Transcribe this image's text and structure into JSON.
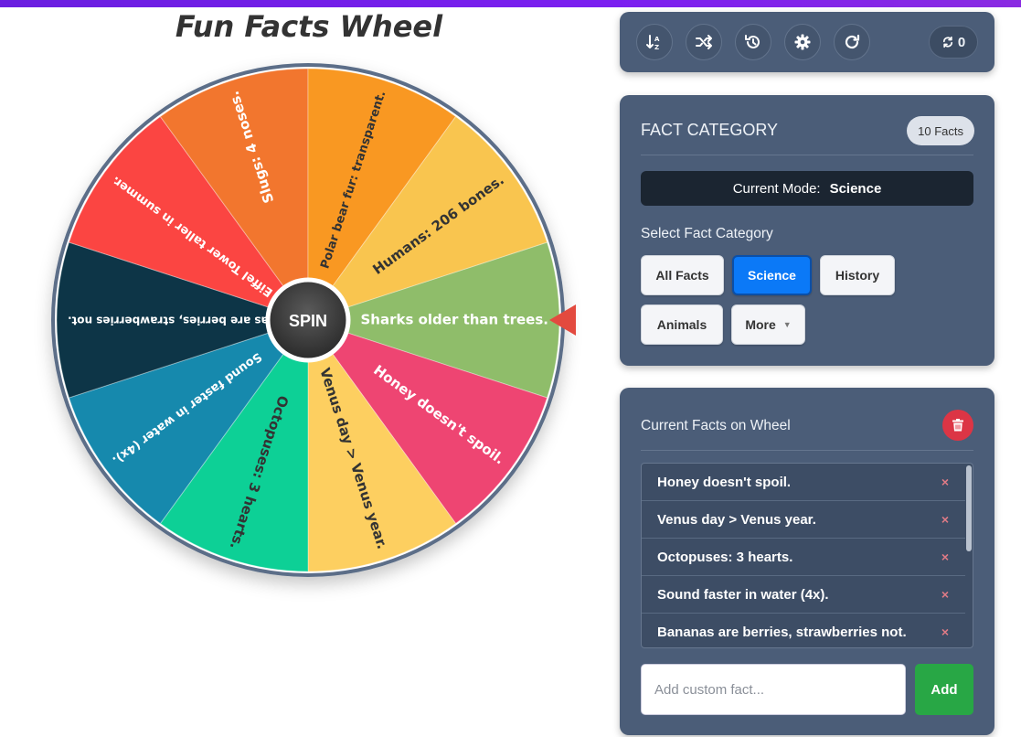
{
  "app": {
    "title": "Fun Facts Wheel",
    "topbar_color": "#7b1ff0"
  },
  "wheel": {
    "spin_label": "SPIN",
    "pointer_color": "#e34a3f",
    "rim_color": "#5b6e88",
    "segments": [
      {
        "label": "Sharks older than trees.",
        "color": "#8fbd6a"
      },
      {
        "label": "Honey doesn't spoil.",
        "color": "#ee4472"
      },
      {
        "label": "Venus day > Venus year.",
        "color": "#fdcf61"
      },
      {
        "label": "Octopuses: 3 hearts.",
        "color": "#0fd096"
      },
      {
        "label": "Sound faster in water (4x).",
        "color": "#1589ad"
      },
      {
        "label": "Bananas are berries, strawberries not.",
        "color": "#0a3646"
      },
      {
        "label": "Eiffel Tower taller in summer.",
        "color": "#fb4542"
      },
      {
        "label": "Slugs: 4 noses.",
        "color": "#f2762d"
      },
      {
        "label": "Polar bear fur: transparent.",
        "color": "#f99820"
      },
      {
        "label": "Humans: 206 bones.",
        "color": "#f9c54f"
      }
    ]
  },
  "toolbar": {
    "buttons": [
      {
        "icon": "sort-icon"
      },
      {
        "icon": "shuffle-icon"
      },
      {
        "icon": "history-icon"
      },
      {
        "icon": "gear-icon"
      },
      {
        "icon": "redo-icon"
      }
    ],
    "spin_count": "0"
  },
  "category": {
    "heading": "FACT CATEGORY",
    "facts_badge": "10 Facts",
    "mode_label": "Current Mode:",
    "mode_value": "Science",
    "select_label": "Select Fact Category",
    "buttons": {
      "all": "All Facts",
      "science": "Science",
      "history": "History",
      "animals": "Animals",
      "more": "More"
    },
    "active": "Science"
  },
  "current": {
    "heading": "Current Facts on Wheel",
    "facts": [
      "Honey doesn't spoil.",
      "Venus day > Venus year.",
      "Octopuses: 3 hearts.",
      "Sound faster in water (4x).",
      "Bananas are berries, strawberries not."
    ],
    "remove_glyph": "×",
    "input_placeholder": "Add custom fact...",
    "add_label": "Add"
  }
}
